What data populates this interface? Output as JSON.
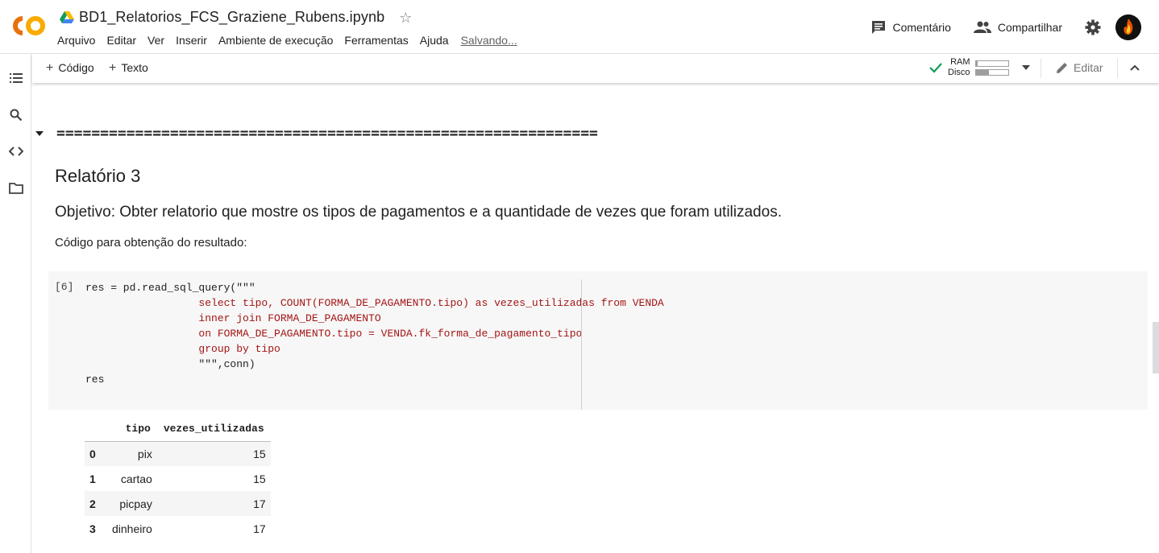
{
  "header": {
    "doc_title": "BD1_Relatorios_FCS_Graziene_Rubens.ipynb",
    "menu": [
      "Arquivo",
      "Editar",
      "Ver",
      "Inserir",
      "Ambiente de execução",
      "Ferramentas",
      "Ajuda"
    ],
    "status": "Salvando...",
    "comment_label": "Comentário",
    "share_label": "Compartilhar",
    "logo_text": "CO"
  },
  "toolbar": {
    "add_code": "Código",
    "add_text": "Texto",
    "ram_label": "RAM",
    "disk_label": "Disco",
    "ram_fraction": 0.05,
    "disk_fraction": 0.4,
    "edit_label": "Editar"
  },
  "colors": {
    "logo_orange": "#f9ab00",
    "check_green": "#0f9d58",
    "string_red": "#a31515"
  },
  "content": {
    "separator": "==============================================================",
    "heading": "Relatório 3",
    "objective": "Objetivo: Obter relatorio que mostre os tipos de pagamentos e a quantidade de vezes que foram utilizados.",
    "code_intro": "Código para obtenção do resultado:"
  },
  "cell": {
    "exec_count": "[6]",
    "line1": "res = pd.read_sql_query(\"\"\"",
    "line2": "                  select tipo, COUNT(FORMA_DE_PAGAMENTO.tipo) as vezes_utilizadas from VENDA",
    "line3": "                  inner join FORMA_DE_PAGAMENTO",
    "line4": "                  on FORMA_DE_PAGAMENTO.tipo = VENDA.fk_forma_de_pagamento_tipo",
    "line5": "                  group by tipo",
    "line6": "",
    "line7": "                  \"\"\",conn)",
    "line8": "res"
  },
  "output_table": {
    "columns": [
      "tipo",
      "vezes_utilizadas"
    ],
    "rows": [
      {
        "index": "0",
        "tipo": "pix",
        "vezes": "15"
      },
      {
        "index": "1",
        "tipo": "cartao",
        "vezes": "15"
      },
      {
        "index": "2",
        "tipo": "picpay",
        "vezes": "17"
      },
      {
        "index": "3",
        "tipo": "dinheiro",
        "vezes": "17"
      }
    ]
  }
}
